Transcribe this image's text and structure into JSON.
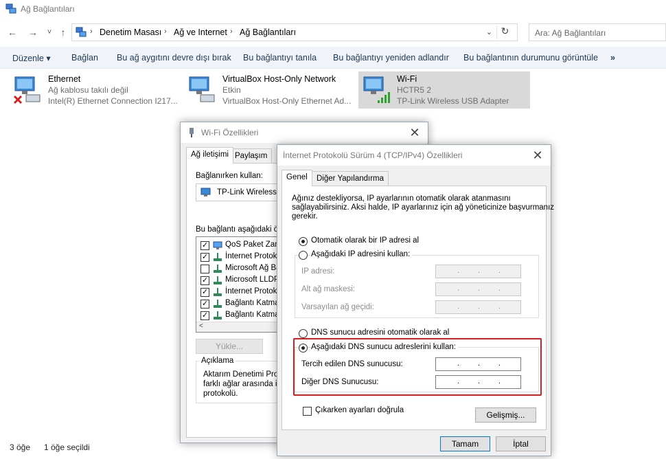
{
  "window": {
    "title": "Ağ Bağlantıları"
  },
  "nav": {
    "back": "←",
    "forward": "→",
    "recent": "˅",
    "up": "↑",
    "refresh": "↻",
    "dropdown": "⌄",
    "sep": "›"
  },
  "breadcrumbs": [
    "Denetim Masası",
    "Ağ ve Internet",
    "Ağ Bağlantıları"
  ],
  "search": {
    "placeholder": "Ara: Ağ Bağlantıları"
  },
  "commands": {
    "organize": "Düzenle",
    "organize_arrow": "▾",
    "connect": "Bağlan",
    "disable": "Bu ağ aygıtını devre dışı bırak",
    "diagnose": "Bu bağlantıyı tanıla",
    "rename": "Bu bağlantıyı yeniden adlandır",
    "status": "Bu bağlantının durumunu görüntüle",
    "more": "»"
  },
  "connections": [
    {
      "name": "Ethernet",
      "status": "Ağ kablosu takılı değil",
      "device": "Intel(R) Ethernet Connection I217..."
    },
    {
      "name": "VirtualBox Host-Only Network",
      "status": "Etkin",
      "device": "VirtualBox Host-Only Ethernet Ad..."
    },
    {
      "name": "Wi-Fi",
      "status": "HCTR5 2",
      "device": "TP-Link Wireless USB Adapter"
    }
  ],
  "statusbar": {
    "count": "3 öğe",
    "selected": "1 öğe seçildi"
  },
  "wifi_dialog": {
    "title": "Wi-Fi Özellikleri",
    "close": "✕",
    "tabs": [
      "Ağ iletişimi",
      "Paylaşım"
    ],
    "connect_using_label": "Bağlanırken kullan:",
    "adapter": "TP-Link Wireless U",
    "items_label": "Bu bağlantı aşağıdaki öğe",
    "items": [
      {
        "label": "QoS Paket Zama",
        "checked": true
      },
      {
        "label": "İnternet Protokol",
        "checked": true
      },
      {
        "label": "Microsoft Ağ Bağ",
        "checked": false
      },
      {
        "label": "Microsoft LLDP",
        "checked": true
      },
      {
        "label": "İnternet Protokol",
        "checked": true
      },
      {
        "label": "Bağlantı Katman",
        "checked": true
      },
      {
        "label": "Bağlantı Katman",
        "checked": true
      }
    ],
    "scroll_left": "<",
    "install_button": "Yükle...",
    "description_title": "Açıklama",
    "description_lines": [
      "Aktarım Denetimi Proto",
      "farklı ağlar arasında ilet",
      "protokolü."
    ]
  },
  "ipv4_dialog": {
    "title": "İnternet Protokolü Sürüm 4 (TCP/IPv4) Özellikleri",
    "close": "✕",
    "tabs": [
      "Genel",
      "Diğer Yapılandırma"
    ],
    "intro_lines": [
      "Ağınız destekliyorsa, IP ayarlarının otomatik olarak atanmasını",
      "sağlayabilirsiniz. Aksi halde, IP ayarlarınız için ağ yöneticinize başvurmanız",
      "gerekir."
    ],
    "auto_ip": "Otomatik olarak bir IP adresi al",
    "manual_ip": "Aşağıdaki IP adresini kullan:",
    "ip_address": "IP adresi:",
    "subnet": "Alt ağ maskesi:",
    "gateway": "Varsayılan ağ geçidi:",
    "auto_dns": "DNS sunucu adresini otomatik olarak al",
    "manual_dns": "Aşağıdaki DNS sunucu adreslerini kullan:",
    "preferred_dns": "Tercih edilen DNS sunucusu:",
    "alternate_dns": "Diğer DNS Sunucusu:",
    "validate": "Çıkarken ayarları doğrula",
    "advanced": "Gelişmiş...",
    "ok": "Tamam",
    "cancel": "İptal",
    "dot": "."
  },
  "colors": {
    "highlight": "#d81e1e",
    "selection": "#d9d9d9",
    "commandbar": "#f0f4f9"
  }
}
